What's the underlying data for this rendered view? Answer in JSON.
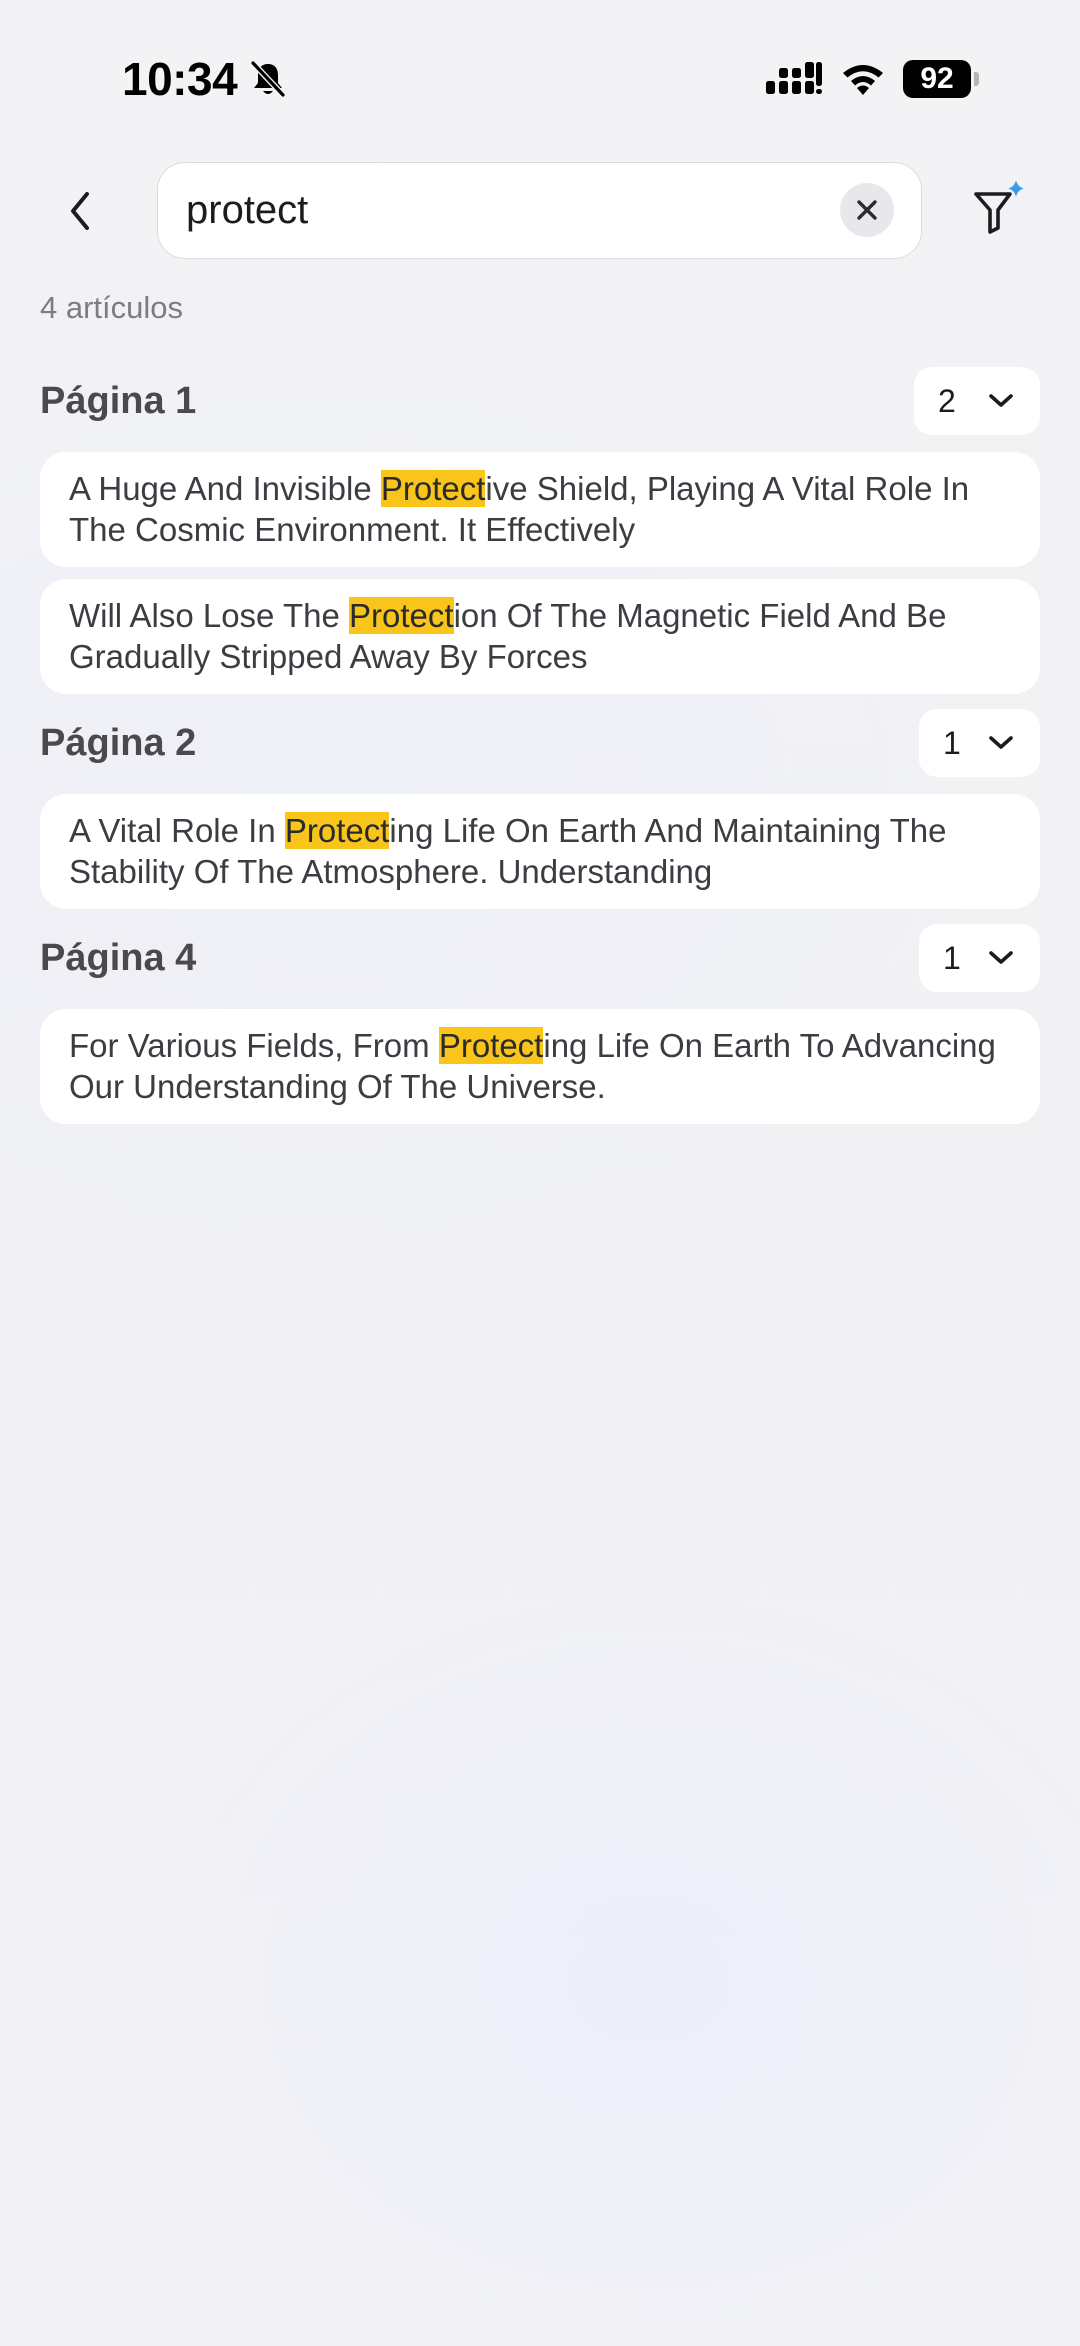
{
  "status_bar": {
    "time": "10:34",
    "battery": "92"
  },
  "search": {
    "query": "protect",
    "placeholder": "",
    "highlight_color": "#f9c51a"
  },
  "result_count": "4 artículos",
  "groups": [
    {
      "title": "Página 1",
      "count": "2",
      "results": [
        {
          "before": "A Huge And Invisible ",
          "match": "Protect",
          "after": "ive Shield, Playing A Vital Role In The Cosmic Environment. It Effectively"
        },
        {
          "before": "Will Also Lose The ",
          "match": "Protect",
          "after": "ion Of The Magnetic Field And Be Gradually Stripped Away By Forces"
        }
      ]
    },
    {
      "title": "Página 2",
      "count": "1",
      "results": [
        {
          "before": "A Vital Role In ",
          "match": "Protect",
          "after": "ing Life On Earth And Maintaining The Stability Of The Atmosphere. Understanding"
        }
      ]
    },
    {
      "title": "Página 4",
      "count": "1",
      "results": [
        {
          "before": "For Various Fields, From ",
          "match": "Protect",
          "after": "ing Life On Earth To Advancing Our Understanding Of The Universe."
        }
      ]
    }
  ],
  "icons": {
    "back": "chevron-left-icon",
    "clear": "close-icon",
    "filter": "ai-filter-icon",
    "group_toggle": "chevron-down-icon"
  }
}
